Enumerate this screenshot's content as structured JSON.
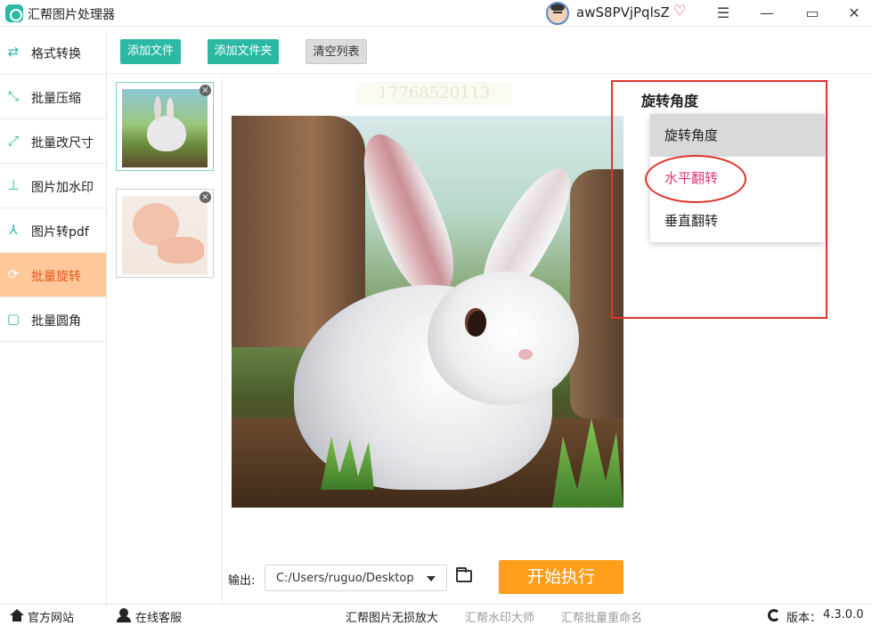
{
  "app": {
    "title": "汇帮图片处理器",
    "username": "awS8PVjPqlsZ"
  },
  "window": {
    "menu_icon": "☰",
    "min_icon": "—",
    "max_icon": "▭",
    "close_icon": "✕"
  },
  "sidebar": {
    "active_index": 5,
    "items": [
      {
        "label": "格式转换",
        "icon": "format-convert-icon",
        "glyph": "⇄"
      },
      {
        "label": "批量压缩",
        "icon": "compress-icon",
        "glyph": "⤡"
      },
      {
        "label": "批量改尺寸",
        "icon": "resize-icon",
        "glyph": "⤢"
      },
      {
        "label": "图片加水印",
        "icon": "watermark-icon",
        "glyph": "⊥"
      },
      {
        "label": "图片转pdf",
        "icon": "pdf-icon",
        "glyph": "⅄"
      },
      {
        "label": "批量旋转",
        "icon": "rotate-icon",
        "glyph": "⟳"
      },
      {
        "label": "批量圆角",
        "icon": "rounded-corner-icon",
        "glyph": "▢"
      }
    ]
  },
  "toolbar": {
    "add_file": "添加文件",
    "add_folder": "添加文件夹",
    "clear_list": "清空列表"
  },
  "thumbnails": [
    {
      "name": "rabbit",
      "close": "×",
      "selected": true
    },
    {
      "name": "baby",
      "close": "×",
      "selected": false
    }
  ],
  "preview": {
    "watermark_text": "17768520113"
  },
  "output": {
    "label": "输出:",
    "path": "C:/Users/ruguo/Desktop"
  },
  "start_button": "开始执行",
  "rotation": {
    "heading": "旋转角度",
    "options": [
      {
        "label": "旋转角度",
        "state": "highlighted"
      },
      {
        "label": "水平翻转",
        "state": "selected"
      },
      {
        "label": "垂直翻转",
        "state": "normal"
      }
    ]
  },
  "footer": {
    "official_site": "官方网站",
    "online_support": "在线客服",
    "links": [
      "汇帮图片无损放大",
      "汇帮水印大师",
      "汇帮批量重命名"
    ],
    "version_label": "版本：",
    "version": "4.3.0.0"
  },
  "colors": {
    "accent": "#2bb9a3",
    "active_bg": "#ffc99c",
    "active_text": "#e8551a",
    "start": "#ff9e1b",
    "annotation": "#e0342a",
    "selected_option": "#e0357a"
  }
}
